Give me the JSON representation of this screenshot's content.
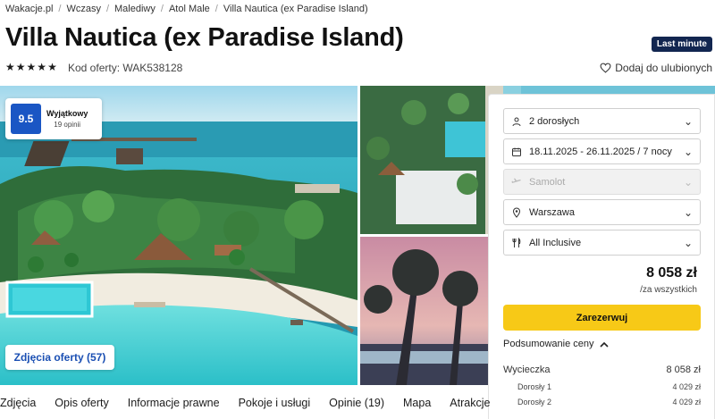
{
  "breadcrumb": [
    "Wakacje.pl",
    "Wczasy",
    "Malediwy",
    "Atol Male",
    "Villa Nautica (ex Paradise Island)"
  ],
  "title": "Villa Nautica (ex Paradise Island)",
  "badge": "Last minute",
  "stars": 5,
  "offer_code": "Kod oferty: WAK538128",
  "favorite_label": "Dodaj do ulubionych",
  "rating": {
    "score": "9.5",
    "label": "Wyjątkowy",
    "count": "19 opinii"
  },
  "photos_button": "Zdjęcia oferty (57)",
  "booking": {
    "travelers": "2 dorosłych",
    "dates": "18.11.2025 - 26.11.2025 / 7 nocy",
    "transport": "Samolot",
    "departure": "Warszawa",
    "board": "All Inclusive",
    "price": "8 058 zł",
    "price_note": "/za wszystkich",
    "reserve_label": "Zarezerwuj",
    "summary_label": "Podsumowanie ceny",
    "summary": [
      {
        "label": "Wycieczka",
        "value": "8 058 zł"
      },
      {
        "label": "Dorosły 1",
        "value": "4 029 zł"
      },
      {
        "label": "Dorosły 2",
        "value": "4 029 zł"
      }
    ]
  },
  "tabs": [
    "Zdjęcia",
    "Opis oferty",
    "Informacje prawne",
    "Pokoje i usługi",
    "Opinie (19)",
    "Mapa",
    "Atrakcje"
  ],
  "colors": {
    "accent_yellow": "#f7c917",
    "rating_blue": "#1a56c4",
    "badge_navy": "#122650",
    "link_blue": "#1a4fb3"
  }
}
